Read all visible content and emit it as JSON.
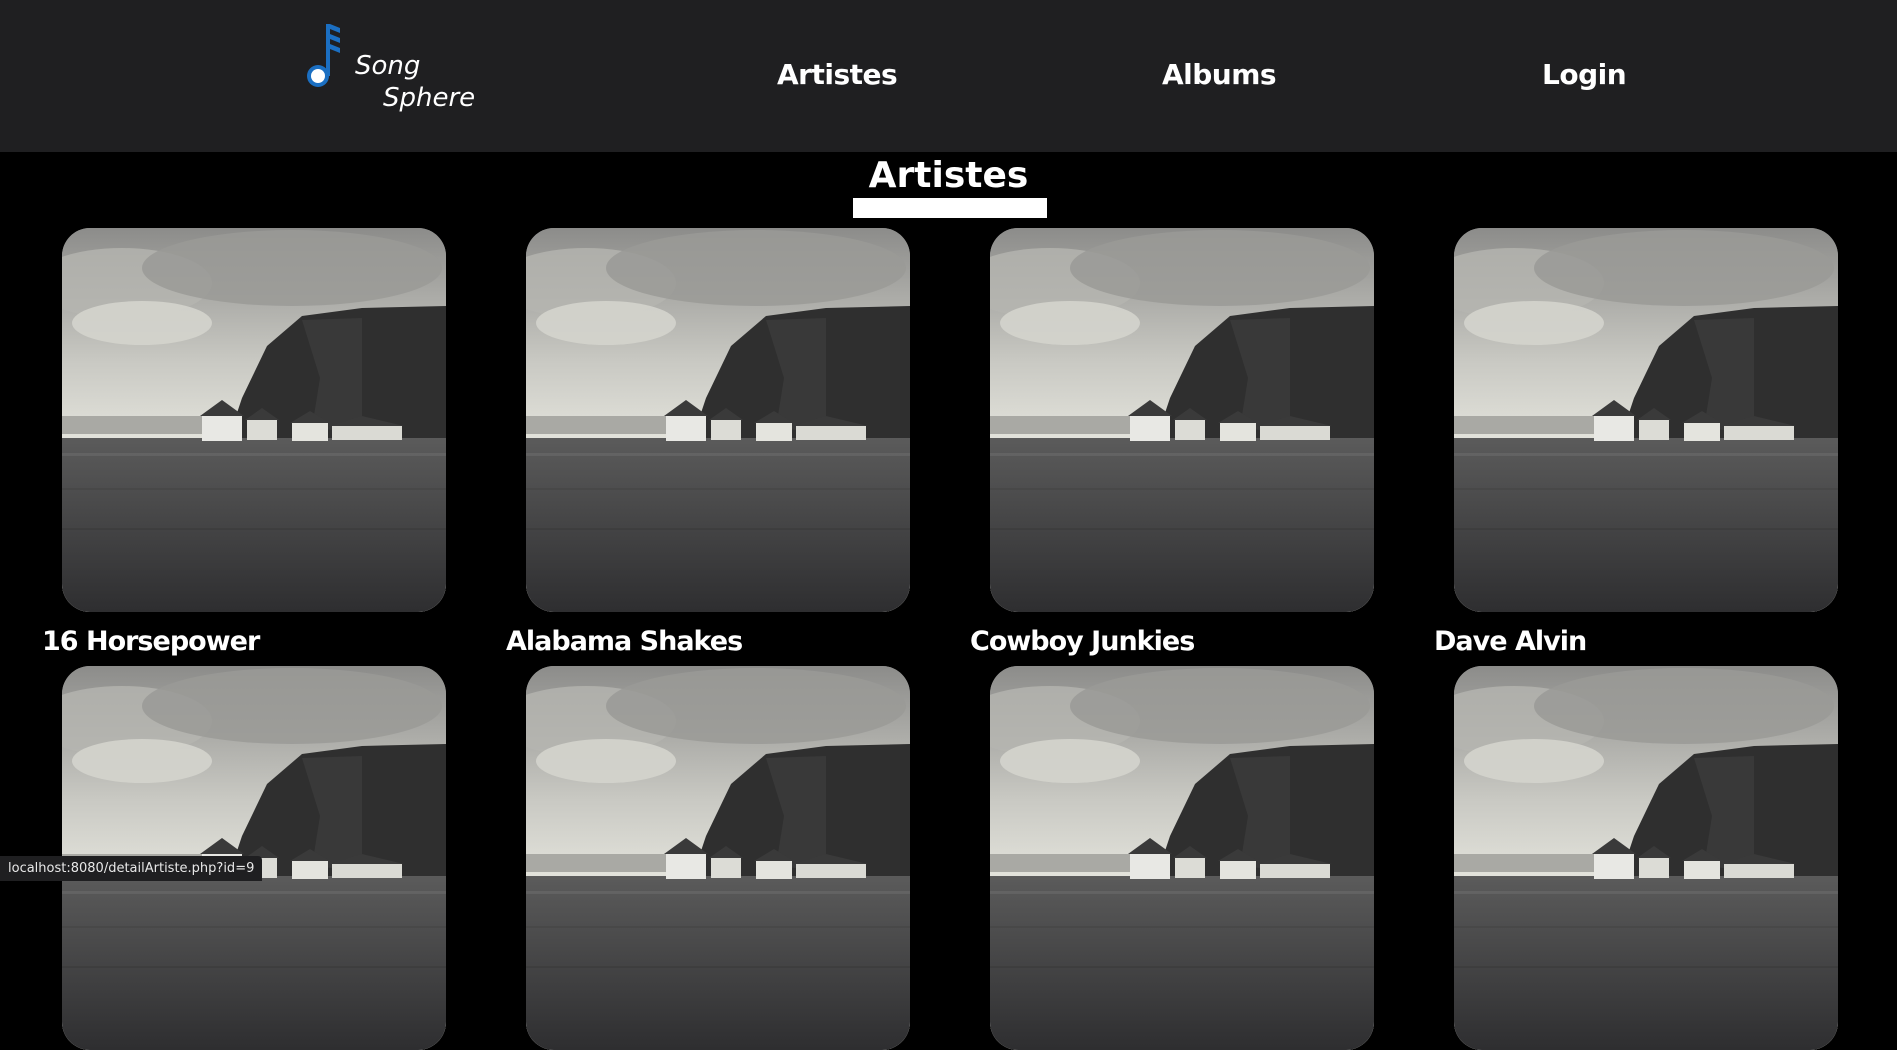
{
  "brand": {
    "line1": "Song",
    "line2": "Sphere",
    "accent_color": "#1b6fc2",
    "icon": "music-note-icon"
  },
  "nav": {
    "artistes": "Artistes",
    "albums": "Albums",
    "login": "Login"
  },
  "page": {
    "title": "Artistes"
  },
  "artists": [
    {
      "name": "16 Horsepower"
    },
    {
      "name": "Alabama Shakes"
    },
    {
      "name": "Cowboy Junkies"
    },
    {
      "name": "Dave Alvin"
    },
    {
      "name": ""
    },
    {
      "name": ""
    },
    {
      "name": ""
    },
    {
      "name": ""
    }
  ],
  "status_bar": {
    "url": "localhost:8080/detailArtiste.php?id=9"
  }
}
